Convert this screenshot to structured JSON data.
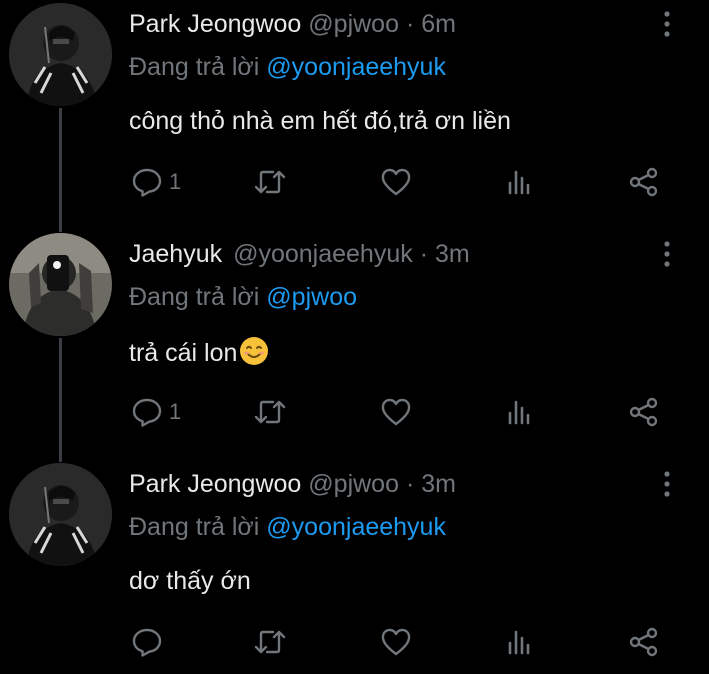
{
  "tweets": [
    {
      "name": "Park Jeongwoo",
      "handle": "@pjwoo",
      "dot": "·",
      "time": "6m",
      "reply_prefix": "Đang trả lời",
      "reply_to": "@yoonjaeehyuk",
      "text": "công thỏ nhà em hết đó,trả ơn liền",
      "reply_count": "1"
    },
    {
      "name": "Jaehyuk",
      "handle": "@yoonjaeehyuk",
      "dot": "·",
      "time": "3m",
      "reply_prefix": "Đang trả lời",
      "reply_to": "@pjwoo",
      "text": "trả cái lon",
      "reply_count": "1"
    },
    {
      "name": "Park Jeongwoo",
      "handle": "@pjwoo",
      "dot": "·",
      "time": "3m",
      "reply_prefix": "Đang trả lời",
      "reply_to": "@yoonjaeehyuk",
      "text": "dơ thấy ớn",
      "reply_count": ""
    }
  ],
  "icons": {
    "reply": "reply-icon",
    "retweet": "retweet-icon",
    "like": "heart-icon",
    "views": "analytics-icon",
    "share": "share-icon",
    "more": "more-vertical-icon",
    "emoji": "smiling-face-emoji"
  },
  "colors": {
    "background": "#000000",
    "text": "#e7e9ea",
    "muted": "#71767b",
    "link": "#1d9bf0",
    "thread_line": "#3a3e42"
  }
}
